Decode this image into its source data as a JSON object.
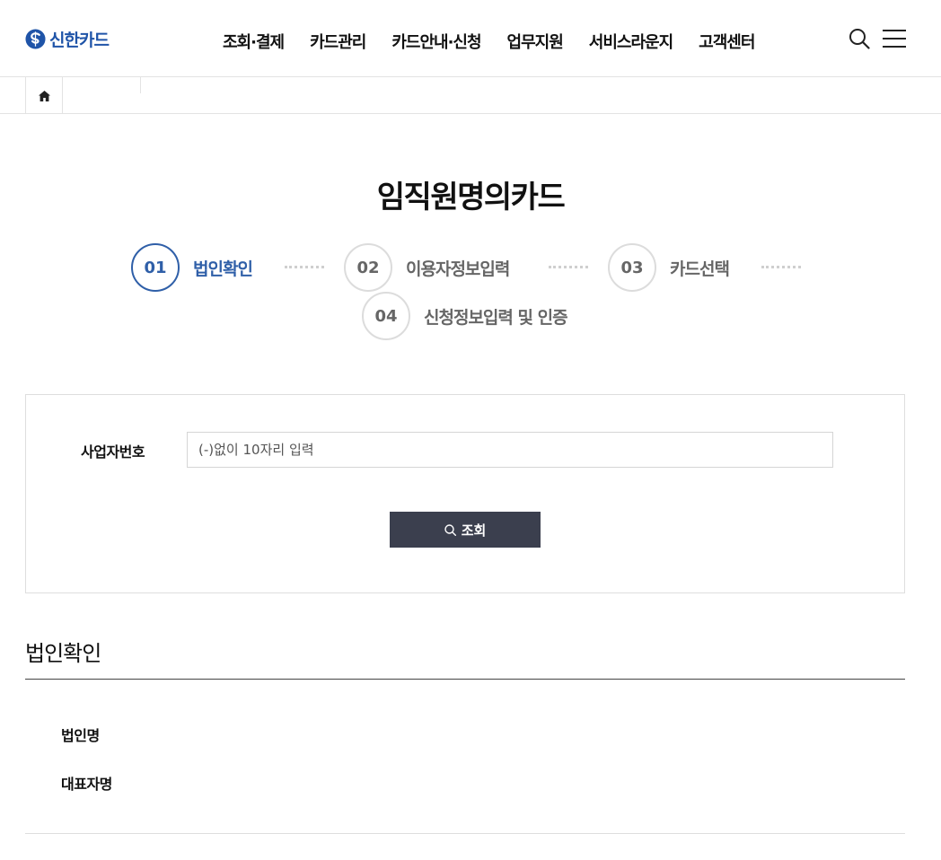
{
  "header": {
    "logo_text": "신한카드",
    "brand_color": "#1f54a8",
    "nav": [
      "조회·결제",
      "카드관리",
      "카드안내·신청",
      "업무지원",
      "서비스라운지",
      "고객센터"
    ],
    "icons": {
      "search": "search-icon",
      "menu": "hamburger-menu-icon",
      "home": "home-icon"
    }
  },
  "page": {
    "title": "임직원명의카드"
  },
  "steps": [
    {
      "num": "01",
      "label": "법인확인",
      "active": true
    },
    {
      "num": "02",
      "label": "이용자정보입력",
      "active": false
    },
    {
      "num": "03",
      "label": "카드선택",
      "active": false
    },
    {
      "num": "04",
      "label": "신청정보입력 및 인증",
      "active": false
    }
  ],
  "form": {
    "biz_no_label": "사업자번호",
    "biz_no_placeholder": "(-)없이 10자리 입력",
    "biz_no_value": "",
    "submit_label": "조회",
    "submit_color": "#3b3f4e"
  },
  "result": {
    "title": "법인확인",
    "corp_name_label": "법인명",
    "ceo_name_label": "대표자명"
  }
}
